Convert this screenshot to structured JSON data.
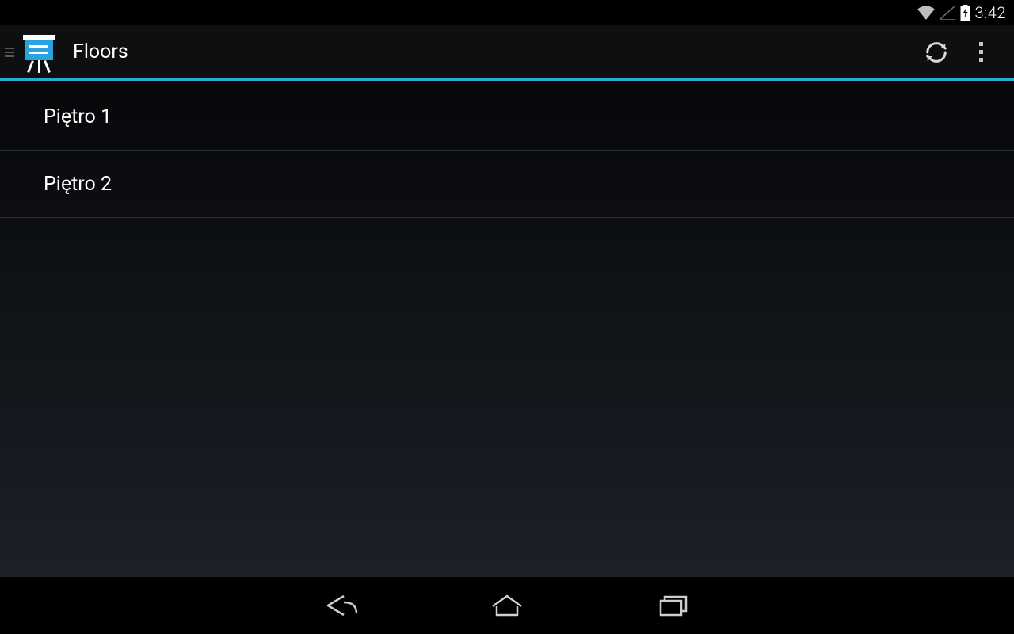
{
  "status": {
    "time": "3:42"
  },
  "actionbar": {
    "title": "Floors"
  },
  "floors": [
    {
      "label": "Piętro 1"
    },
    {
      "label": "Piętro 2"
    }
  ]
}
